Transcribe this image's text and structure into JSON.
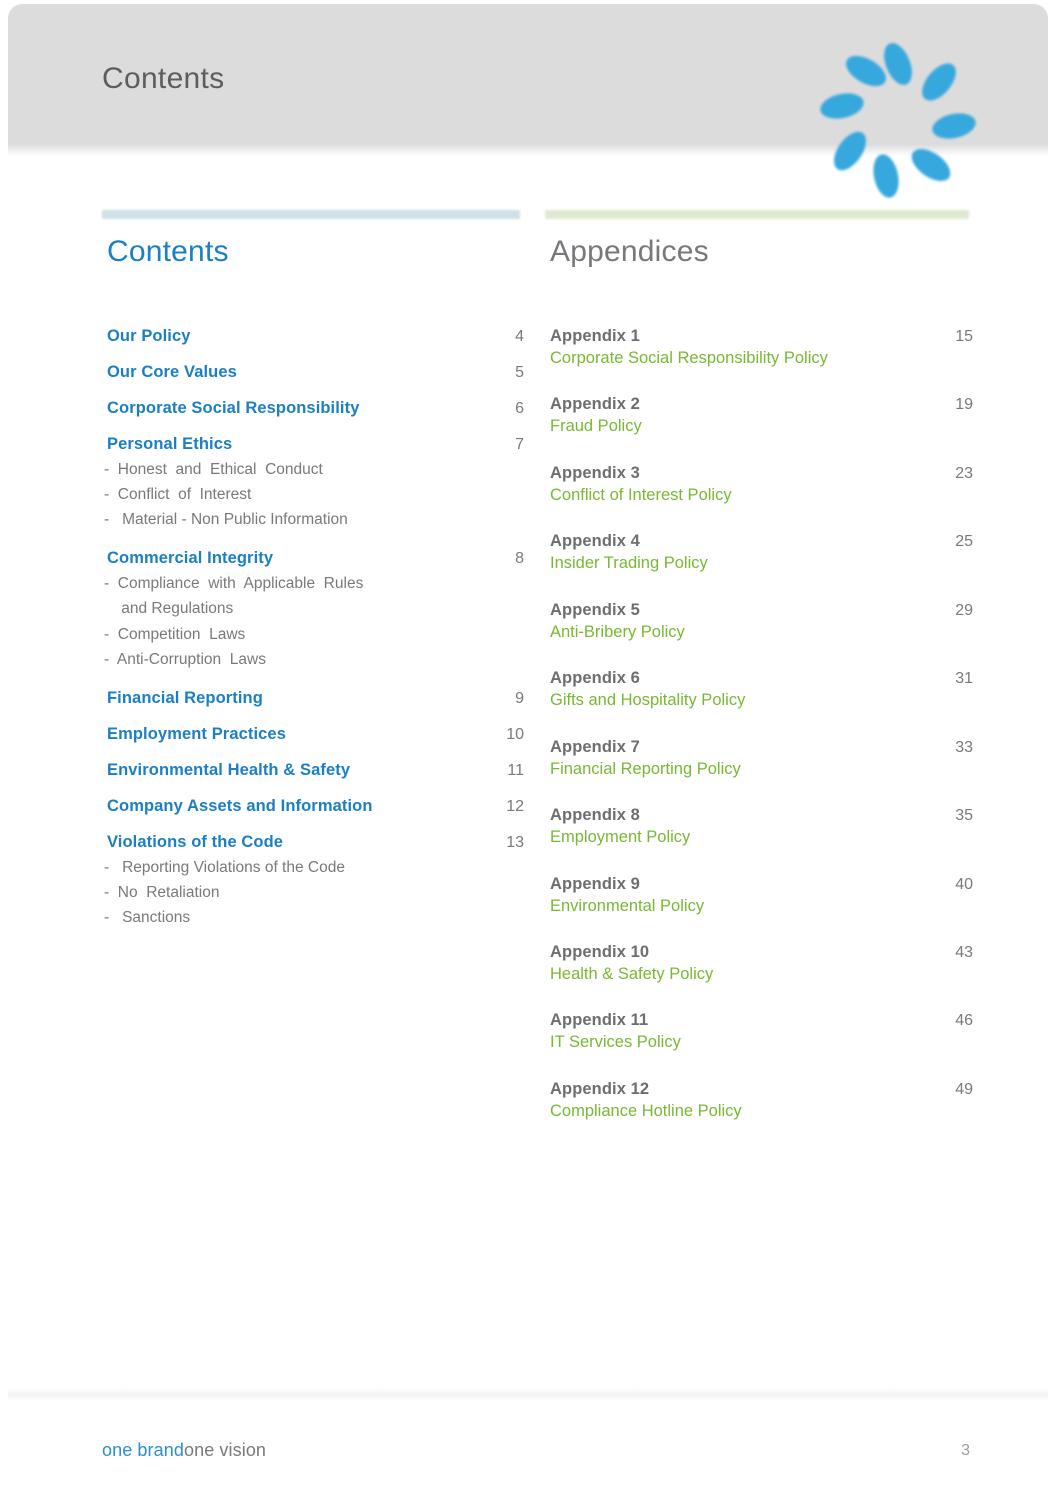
{
  "header": {
    "title": "Contents",
    "logo_icon": "sunburst-logo-icon"
  },
  "colors": {
    "blue": "#1b7fc4",
    "green": "#78b833",
    "gray": "#77797c",
    "header_band": "#dcdcdc",
    "rule_blue": "#cfe0e6",
    "rule_green": "#dfe9cf"
  },
  "contents": {
    "title": "Contents",
    "entries": [
      {
        "label": "Our Policy",
        "page": "4",
        "subs": []
      },
      {
        "label": "Our Core Values",
        "page": "5",
        "subs": []
      },
      {
        "label": "Corporate Social Responsibility",
        "page": "6",
        "subs": []
      },
      {
        "label": "Personal Ethics",
        "page": "7",
        "subs": [
          "-  Honest  and  Ethical  Conduct",
          "-  Conflict  of  Interest",
          "-   Material - Non Public Information"
        ]
      },
      {
        "label": "Commercial Integrity",
        "page": "8",
        "subs": [
          "-  Compliance  with  Applicable  Rules",
          "    and Regulations",
          "-  Competition  Laws",
          "-  Anti-Corruption  Laws"
        ]
      },
      {
        "label": "Financial Reporting",
        "page": "9",
        "subs": []
      },
      {
        "label": "Employment Practices",
        "page": "10",
        "subs": []
      },
      {
        "label": "Environmental Health & Safety",
        "page": "11",
        "subs": []
      },
      {
        "label": "Company Assets and Information",
        "page": "12",
        "subs": []
      },
      {
        "label": "Violations of the Code",
        "page": "13",
        "subs": [
          "-   Reporting Violations of the Code",
          "-  No  Retaliation",
          "-   Sanctions"
        ]
      }
    ]
  },
  "appendices": {
    "title": "Appendices",
    "entries": [
      {
        "label": "Appendix 1",
        "page": "15",
        "policy": "Corporate Social Responsibility Policy"
      },
      {
        "label": "Appendix 2",
        "page": "19",
        "policy": "Fraud Policy"
      },
      {
        "label": "Appendix 3",
        "page": "23",
        "policy": "Conflict of Interest Policy"
      },
      {
        "label": "Appendix 4",
        "page": "25",
        "policy": "Insider Trading Policy"
      },
      {
        "label": "Appendix 5",
        "page": "29",
        "policy": "Anti-Bribery Policy"
      },
      {
        "label": "Appendix 6",
        "page": "31",
        "policy": "Gifts and Hospitality Policy"
      },
      {
        "label": "Appendix 7",
        "page": "33",
        "policy": "Financial Reporting Policy"
      },
      {
        "label": "Appendix 8",
        "page": "35",
        "policy": "Employment Policy"
      },
      {
        "label": "Appendix 9",
        "page": "40",
        "policy": "Environmental Policy"
      },
      {
        "label": "Appendix 10",
        "page": "43",
        "policy": "Health & Safety Policy"
      },
      {
        "label": "Appendix 11",
        "page": "46",
        "policy": "IT Services Policy"
      },
      {
        "label": "Appendix 12",
        "page": "49",
        "policy": "Compliance Hotline Policy"
      }
    ]
  },
  "footer": {
    "brand_primary": "one brand",
    "brand_secondary": "one vision",
    "page_number": "3"
  }
}
